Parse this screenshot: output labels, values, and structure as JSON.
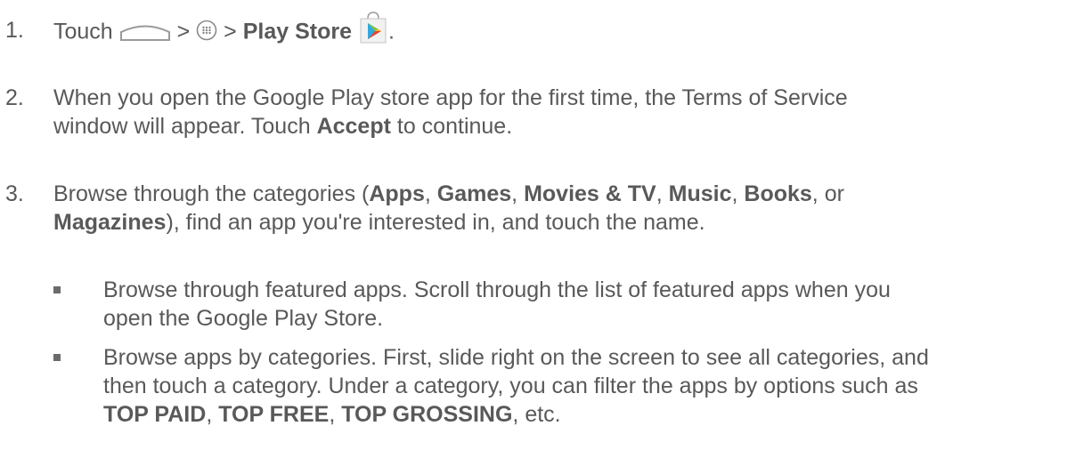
{
  "steps": [
    {
      "number": "1.",
      "lead": "Touch",
      "sep1": ">",
      "sep2": ">",
      "target": "Play Store",
      "end": ".",
      "icons": [
        "home-icon",
        "apps-icon",
        "play-store-icon"
      ]
    },
    {
      "number": "2.",
      "line1": "When you open the Google Play store app for the first time, the Terms of Service",
      "line2_pre": "window will appear. Touch",
      "accept": "Accept",
      "line2_post": "to continue."
    },
    {
      "number": "3.",
      "line1_pre": "Browse through the categories (",
      "apps": "Apps",
      "comma1": ",",
      "games": "Games",
      "comma2": ",",
      "movies": "Movies & TV",
      "comma3": ",",
      "music": "Music",
      "comma4": ",",
      "books": "Books",
      "line1_post": ", or",
      "magazines": "Magazines",
      "line2_post": "), find an app you're interested in, and touch the name."
    }
  ],
  "bullets": [
    {
      "line1": "Browse through featured apps. Scroll through the list of featured apps when you",
      "line2": "open the Google Play Store."
    },
    {
      "line1": "Browse apps by categories. First, slide right on the screen to see all categories, and",
      "line2": "then touch a category. Under a category, you can filter the apps by options such as",
      "top_paid": "TOP PAID",
      "comma1": ",",
      "top_free": "TOP FREE",
      "comma2": ",",
      "top_grossing": "TOP GROSSING",
      "line3_post": ", etc."
    }
  ]
}
